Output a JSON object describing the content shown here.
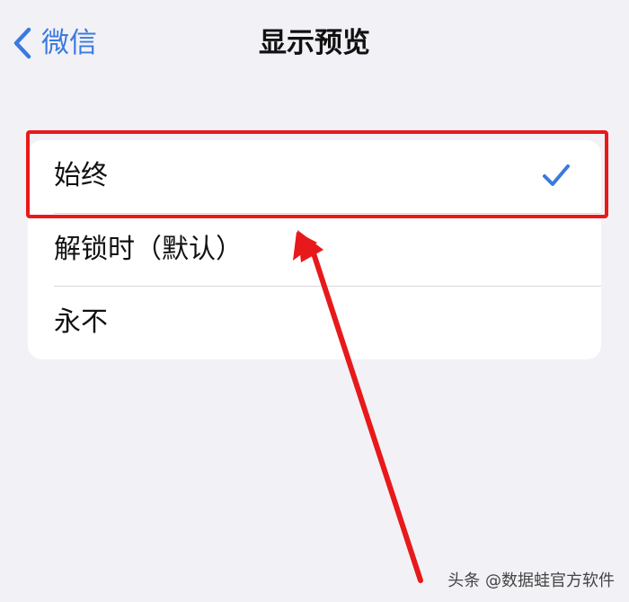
{
  "nav": {
    "back_label": "微信",
    "title": "显示预览"
  },
  "options": [
    {
      "label": "始终",
      "selected": true
    },
    {
      "label": "解锁时（默认）",
      "selected": false
    },
    {
      "label": "永不",
      "selected": false
    }
  ],
  "colors": {
    "accent": "#3a7ae0",
    "highlight": "#e8191a",
    "background": "#f2f1f6"
  },
  "watermark": "头条 @数据蛙官方软件"
}
